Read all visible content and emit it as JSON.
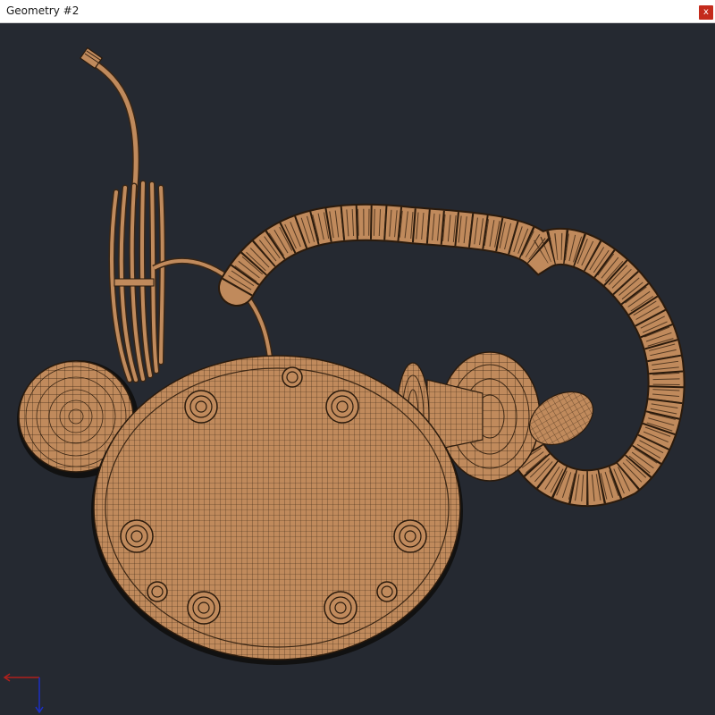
{
  "window": {
    "title": "Geometry #2",
    "close_label": "x"
  },
  "viewport": {
    "background": "#252931",
    "model_fill": "#c08a5c",
    "wire_color": "#3a2614"
  },
  "axis_gizmo": {
    "x_color": "#b0201c",
    "y_color": "#1c2fc4"
  }
}
